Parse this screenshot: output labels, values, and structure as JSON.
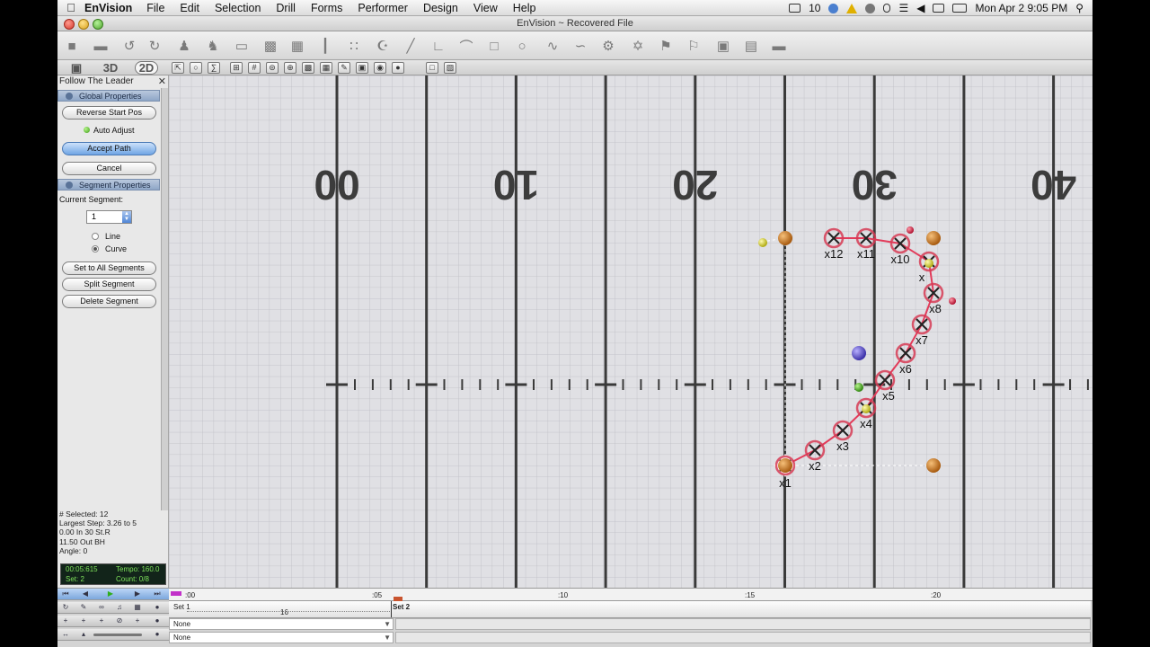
{
  "menubar": {
    "app_name": "EnVision",
    "items": [
      "File",
      "Edit",
      "Selection",
      "Drill",
      "Forms",
      "Performer",
      "Design",
      "View",
      "Help"
    ],
    "status_count": "10",
    "clock": "Mon Apr 2  9:05 PM"
  },
  "window": {
    "title": "EnVision ~ Recovered File"
  },
  "toolbar2": {
    "view_3d": "3D",
    "view_2d": "2D"
  },
  "panel": {
    "title": "Follow The Leader",
    "global_header": "Global Properties",
    "reverse_btn": "Reverse Start Pos",
    "auto_adjust": "Auto Adjust",
    "accept_btn": "Accept Path",
    "cancel_btn": "Cancel",
    "segment_header": "Segment Properties",
    "current_segment_label": "Current Segment:",
    "current_segment_value": "1",
    "opt_line": "Line",
    "opt_curve": "Curve",
    "set_all_btn": "Set to All Segments",
    "split_btn": "Split Segment",
    "delete_btn": "Delete Segment",
    "stats": {
      "selected": "# Selected: 12",
      "largest_step": "Largest Step: 3.26 to 5",
      "pos1": "0.00 In 30 St.R",
      "pos2": "11.50 Out BH",
      "angle": "Angle: 0"
    },
    "counter": {
      "time": "00:05:615",
      "tempo": "Tempo: 160.0",
      "set": "Set: 2",
      "count": "Count: 0/8"
    }
  },
  "field": {
    "yard_numbers": [
      "00",
      "10",
      "20",
      "30",
      "40"
    ],
    "performers": [
      "x1",
      "x2",
      "x3",
      "x4",
      "x5",
      "x6",
      "x7",
      "x8",
      "x",
      "x10",
      "x11",
      "x12"
    ]
  },
  "timeline": {
    "ticks": [
      ":00",
      ":05",
      ":10",
      ":15",
      ":20"
    ],
    "set1": "Set 1",
    "set1_count": "16",
    "set2": "Set 2",
    "row1": "None",
    "row2": "None"
  },
  "colors": {
    "path": "#e23b5a",
    "marker_ring": "#d63b55",
    "yard_line": "#3a3a3a",
    "orange_handle": "#c97a22",
    "yellow_handle": "#e3df2f",
    "blue_handle": "#5b4fd0",
    "green_handle": "#4ab821"
  }
}
